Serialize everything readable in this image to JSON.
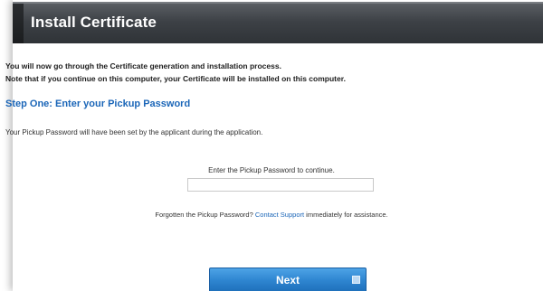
{
  "window": {
    "title": "Install Certificate"
  },
  "intro": {
    "line1": "You will now go through the Certificate generation and installation process.",
    "line2": "Note that if you continue on this computer, your Certificate will be installed on this computer."
  },
  "step": {
    "heading": "Step One: Enter your Pickup Password",
    "description": "Your Pickup Password will have been set by the applicant during the application."
  },
  "form": {
    "prompt": "Enter the Pickup Password to continue.",
    "password_value": "",
    "password_placeholder": ""
  },
  "help": {
    "prefix": "Forgotten the Pickup Password?",
    "link_label": "Contact Support",
    "suffix": "immediately for assistance."
  },
  "actions": {
    "next_label": "Next",
    "next_icon": "arrow-icon"
  },
  "colors": {
    "title_bar": "#3d4146",
    "accent_blue": "#1b66b8",
    "button_blue": "#2f86d1"
  }
}
